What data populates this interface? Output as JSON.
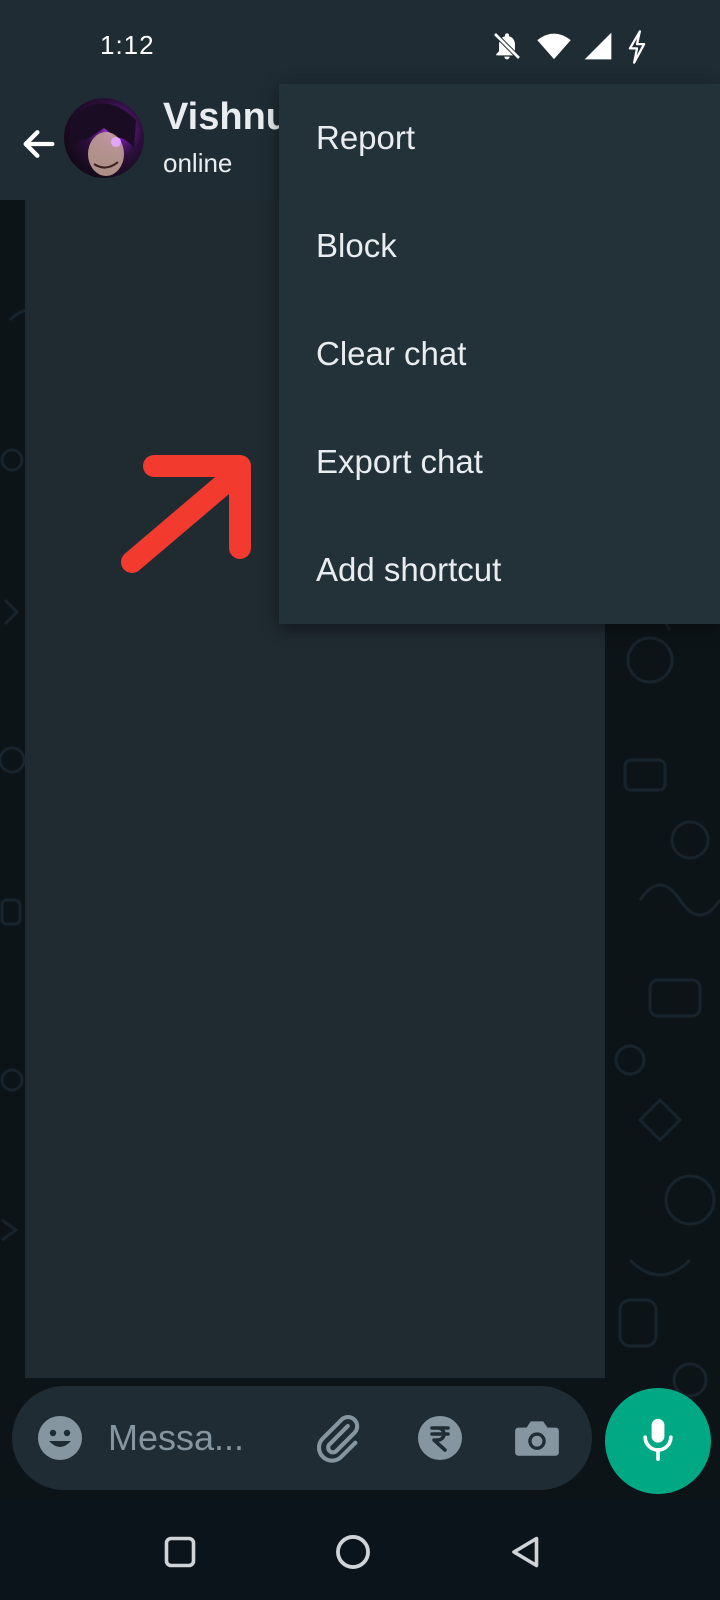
{
  "status_bar": {
    "time": "1:12",
    "icons": [
      "notifications-off-icon",
      "wifi-icon",
      "cell-signal-icon",
      "battery-charging-icon"
    ]
  },
  "header": {
    "contact_name": "Vishnu",
    "contact_status": "online",
    "back_icon": "arrow-left-icon"
  },
  "menu": {
    "items": [
      {
        "label": "Report"
      },
      {
        "label": "Block"
      },
      {
        "label": "Clear chat"
      },
      {
        "label": "Export chat"
      },
      {
        "label": "Add shortcut"
      }
    ]
  },
  "annotation": {
    "color": "#f23b2e",
    "icon": "red-arrow-annotation"
  },
  "composer": {
    "placeholder": "Messa...",
    "icons": [
      "emoji-icon",
      "attach-icon",
      "rupee-payment-icon",
      "camera-icon",
      "mic-icon"
    ],
    "mic_color": "#00a884"
  },
  "nav_bar": {
    "icons": [
      "recent-apps-icon",
      "home-icon",
      "back-icon"
    ]
  },
  "colors": {
    "header_bg": "#1f2c34",
    "menu_bg": "#233138",
    "accent": "#00a884"
  }
}
